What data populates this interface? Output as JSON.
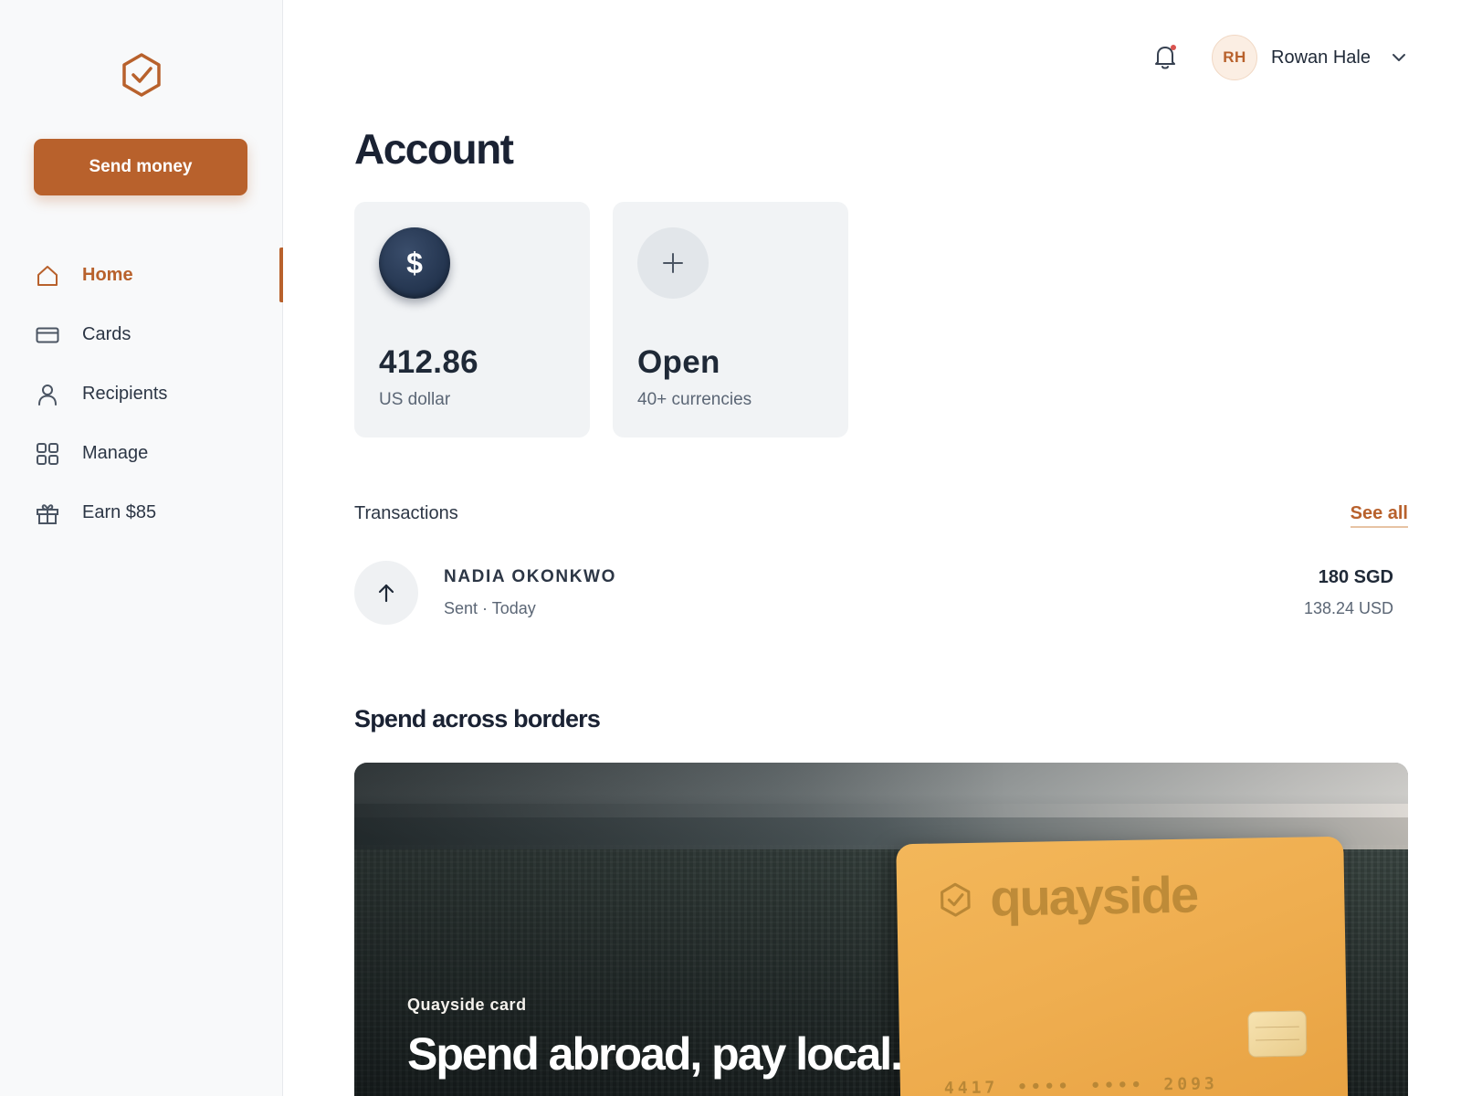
{
  "brand": {
    "accent": "#b8612c",
    "icon": "hexagon-check-icon"
  },
  "sidebar": {
    "send_label": "Send money",
    "items": [
      {
        "label": "Home",
        "icon": "home-icon",
        "active": true
      },
      {
        "label": "Cards",
        "icon": "card-icon",
        "active": false
      },
      {
        "label": "Recipients",
        "icon": "person-icon",
        "active": false
      },
      {
        "label": "Manage",
        "icon": "grid-icon",
        "active": false
      },
      {
        "label": "Earn $85",
        "icon": "gift-icon",
        "active": false
      }
    ]
  },
  "header": {
    "notifications_icon": "bell-icon",
    "user": {
      "initials": "RH",
      "name": "Rowan Hale"
    }
  },
  "main": {
    "title": "Account",
    "balances": [
      {
        "symbol": "$",
        "amount": "412.86",
        "label": "US dollar"
      },
      {
        "symbol": "+",
        "amount": "Open",
        "label": "40+ currencies"
      }
    ],
    "transactions": {
      "title": "Transactions",
      "see_all": "See all",
      "items": [
        {
          "name": "NADIA OKONKWO",
          "meta": "Sent · Today",
          "amount": "180 SGD",
          "sub_amount": "138.24 USD",
          "icon": "arrow-up-icon"
        }
      ]
    },
    "promo": {
      "section_title": "Spend across borders",
      "kicker": "Quayside card",
      "headline": "Spend abroad, pay local.",
      "card": {
        "brand": "quayside",
        "number": "4417 •••• •••• 2093"
      }
    }
  }
}
